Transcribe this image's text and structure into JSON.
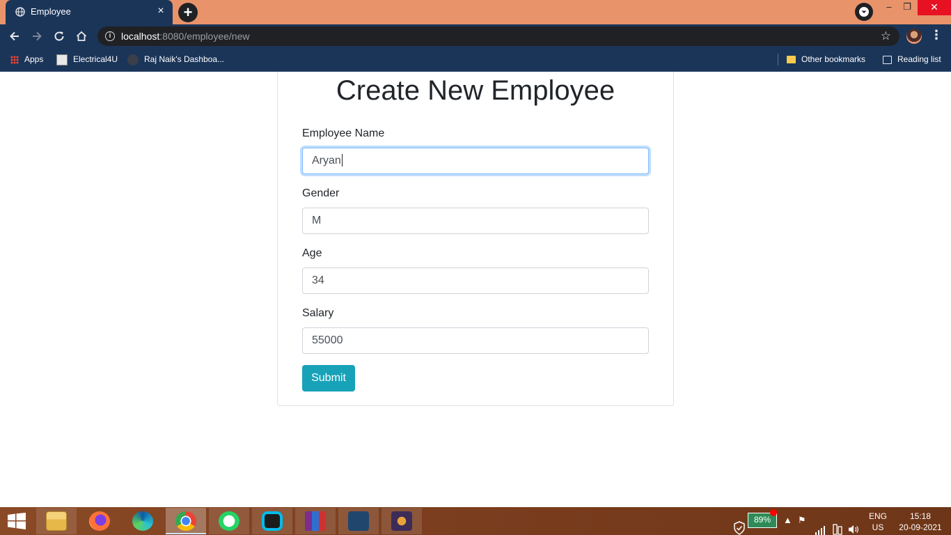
{
  "browser": {
    "tab_title": "Employee",
    "close_glyph": "×",
    "new_tab_glyph": "+",
    "window_controls": {
      "minimize": "–",
      "restore": "❐",
      "close": "✕"
    },
    "url_host": "localhost",
    "url_path": ":8080/employee/new",
    "info_glyph": "i",
    "star_glyph": "☆",
    "menu_glyph": "⋮"
  },
  "bookmarks": {
    "items": [
      {
        "label": "Apps",
        "icon": "apps-grid-icon"
      },
      {
        "label": "Electrical4U",
        "icon": "electrical4u-icon"
      },
      {
        "label": "Raj Naik's Dashboa...",
        "icon": "profile-icon"
      }
    ],
    "other_bookmarks": "Other bookmarks",
    "reading_list": "Reading list"
  },
  "form": {
    "title": "Create New Employee",
    "fields": [
      {
        "label": "Employee Name",
        "value": "Aryan"
      },
      {
        "label": "Gender",
        "value": "M"
      },
      {
        "label": "Age",
        "value": "34"
      },
      {
        "label": "Salary",
        "value": "55000"
      }
    ],
    "submit_label": "Submit"
  },
  "taskbar": {
    "apps": [
      "file-explorer",
      "firefox",
      "edge",
      "chrome",
      "whatsapp",
      "webex",
      "winrar",
      "mysql-workbench",
      "java-ee-ide"
    ],
    "active_app": "chrome",
    "battery": "89%",
    "language_line1": "ENG",
    "language_line2": "US",
    "time": "15:18",
    "date": "20-09-2021",
    "colors": {
      "accent": "#17a2b8",
      "battery": "#2e8b57",
      "notification": "#ff0000"
    }
  }
}
